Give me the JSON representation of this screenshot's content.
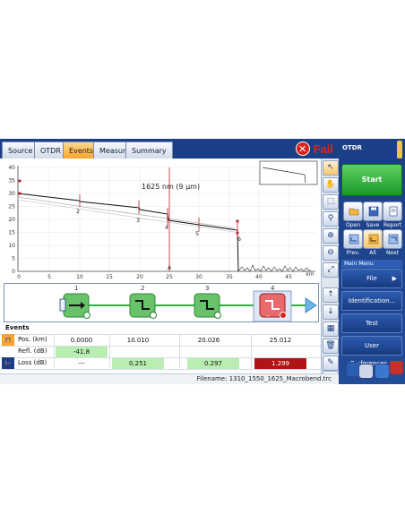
{
  "tabs": [
    "Source",
    "OTDR",
    "Events",
    "Measure",
    "Summary"
  ],
  "active_tab": "Events",
  "status": {
    "label": "Fail",
    "color": "#e12318"
  },
  "plot": {
    "title": "1625 nm (9 μm)",
    "y_ticks": [
      "40",
      "35",
      "30",
      "25",
      "20",
      "15",
      "10",
      "5",
      "0"
    ],
    "x_ticks": [
      "0",
      "5",
      "10",
      "15",
      "20",
      "25",
      "30",
      "35",
      "40",
      "45"
    ],
    "x_unit": "km",
    "marker_label": "A",
    "event_labels": [
      "2",
      "3",
      "4",
      "5",
      "6"
    ]
  },
  "events_strip": {
    "numbers": [
      "1",
      "2",
      "3",
      "4"
    ]
  },
  "events_table": {
    "title": "Events",
    "rows": [
      {
        "label": "Pos. (km)",
        "values": [
          "0.0000",
          "10.010",
          "20.026",
          "25.012"
        ]
      },
      {
        "label": "Refl. (dB)",
        "values": [
          "-41.8",
          "",
          "",
          ""
        ]
      },
      {
        "label": "Loss (dB)",
        "values": [
          "---",
          "0.251",
          "0.297",
          "1.299"
        ]
      }
    ]
  },
  "filename": "Filename: 1310_1550_1625_Macrobend.trc",
  "side": {
    "title": "OTDR",
    "start_label": "Start",
    "buttons": [
      {
        "label": "Open",
        "icon": "folder-icon"
      },
      {
        "label": "Save",
        "icon": "save-icon"
      },
      {
        "label": "Report",
        "icon": "report-icon"
      },
      {
        "label": "Prev.",
        "icon": "prev-icon"
      },
      {
        "label": "All",
        "icon": "all-icon"
      },
      {
        "label": "Next",
        "icon": "next-icon"
      }
    ],
    "main_menu_label": "Main Menu",
    "menu": [
      "File",
      "Identification...",
      "Test Configuration...",
      "User Preferences..."
    ]
  },
  "colors": {
    "accent": "#1b3f86",
    "active_tab": "#f6a531",
    "pass": "#2bb240",
    "fail": "#d8221a"
  }
}
